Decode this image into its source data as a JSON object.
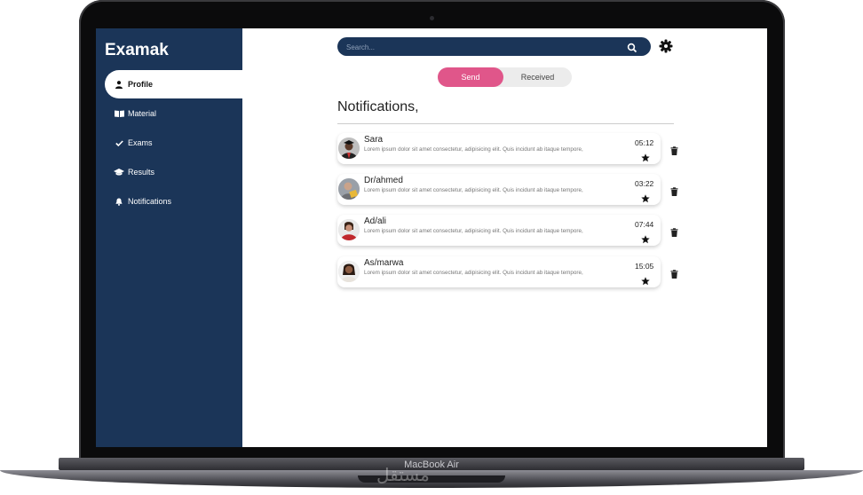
{
  "device": {
    "brand_label": "MacBook Air",
    "watermark": "مستقل"
  },
  "app": {
    "logo": "Examak"
  },
  "sidebar": {
    "items": [
      {
        "label": "Profile",
        "icon": "user-icon",
        "active": true
      },
      {
        "label": "Material",
        "icon": "book-icon",
        "active": false
      },
      {
        "label": "Exams",
        "icon": "check-icon",
        "active": false
      },
      {
        "label": "Results",
        "icon": "graduation-cap-icon",
        "active": false
      },
      {
        "label": "Notifications",
        "icon": "bell-icon",
        "active": false
      }
    ]
  },
  "header": {
    "search_placeholder": "Search..."
  },
  "toggle": {
    "send_label": "Send",
    "received_label": "Received",
    "active": "Send"
  },
  "main": {
    "title": "Notifications,"
  },
  "notifications": [
    {
      "name": "Sara",
      "message": "Lorem ipsum dolor sit amet consectetur, adipisicing elit. Quis incidunt ab itaque tempore,",
      "time": "05:12"
    },
    {
      "name": "Dr/ahmed",
      "message": "Lorem ipsum dolor sit amet consectetur, adipisicing elit. Quis incidunt ab itaque tempore,",
      "time": "03:22"
    },
    {
      "name": "Ad/ali",
      "message": "Lorem ipsum dolor sit amet consectetur, adipisicing elit. Quis incidunt ab itaque tempore,",
      "time": "07:44"
    },
    {
      "name": "As/marwa",
      "message": "Lorem ipsum dolor sit amet consectetur, adipisicing elit. Quis incidunt ab itaque tempore,",
      "time": "15:05"
    }
  ],
  "colors": {
    "sidebar": "#1b3558",
    "accent": "#e0568a"
  }
}
